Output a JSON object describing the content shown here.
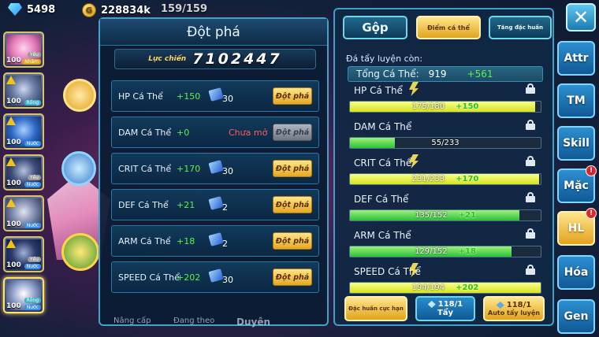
{
  "currency": {
    "gems": "5498",
    "coins": "228834k",
    "stamina": "159/159"
  },
  "party": [
    {
      "level": "100",
      "tag_top": "Yếu",
      "tag_bottom": "Nhâm"
    },
    {
      "level": "100",
      "tag_top": "",
      "tag_bottom": "Rồng"
    },
    {
      "level": "100",
      "tag_top": "",
      "tag_bottom": "Nước"
    },
    {
      "level": "100",
      "tag_top": "Yếu",
      "tag_bottom": "Nước"
    },
    {
      "level": "100",
      "tag_top": "",
      "tag_bottom": "Nước"
    },
    {
      "level": "100",
      "tag_top": "Yếu",
      "tag_bottom": "Nước"
    },
    {
      "level": "100",
      "tag_top": "Rồng",
      "tag_bottom": "Nước"
    }
  ],
  "breakthrough": {
    "title": "Đột phá",
    "power_label": "Lực chiến",
    "power_value": "7102447",
    "rows": [
      {
        "name": "HP Cá Thể",
        "plus": "+150",
        "qty": "30",
        "button": "Đột phá",
        "not_open": ""
      },
      {
        "name": "DAM Cá Thể",
        "plus": "+0",
        "qty": "",
        "button": "Đột phá",
        "not_open": "Chưa mở"
      },
      {
        "name": "CRIT Cá Thể",
        "plus": "+170",
        "qty": "30",
        "button": "Đột phá",
        "not_open": ""
      },
      {
        "name": "DEF Cá Thể",
        "plus": "+21",
        "qty": "2",
        "button": "Đột phá",
        "not_open": ""
      },
      {
        "name": "ARM Cá Thể",
        "plus": "+18",
        "qty": "2",
        "button": "Đột phá",
        "not_open": ""
      },
      {
        "name": "SPEED Cá Thể",
        "plus": "+202",
        "qty": "30",
        "button": "Đột phá",
        "not_open": ""
      }
    ]
  },
  "bottom_tabs": [
    "Nâng cấp",
    "Đang theo",
    "Duyên"
  ],
  "stats_panel": {
    "tabs": {
      "merge": "Gộp",
      "individual": "Điểm cá thể",
      "special": "Tăng đặc huấn"
    },
    "remain_label": "Đá tẩy luyện còn:",
    "total": {
      "name": "Tổng Cá Thể:",
      "value": "919",
      "plus": "+561"
    },
    "stats": [
      {
        "name": "HP Cá Thể",
        "value": "175/180",
        "plus": "+150",
        "fill": 0.97,
        "maxed": true
      },
      {
        "name": "DAM Cá Thể",
        "value": "55/233",
        "plus": "",
        "fill": 0.236,
        "maxed": false
      },
      {
        "name": "CRIT Cá Thể",
        "value": "231/233",
        "plus": "+170",
        "fill": 0.99,
        "maxed": true
      },
      {
        "name": "DEF Cá Thể",
        "value": "135/152",
        "plus": "+21",
        "fill": 0.888,
        "maxed": false
      },
      {
        "name": "ARM Cá Thể",
        "value": "129/152",
        "plus": "+18",
        "fill": 0.849,
        "maxed": false
      },
      {
        "name": "SPEED Cá Thể",
        "value": "194/194",
        "plus": "+202",
        "fill": 1.0,
        "maxed": true
      }
    ],
    "actions": {
      "special_train": "Đặc huấn cực hạn",
      "wash_count": "118/1",
      "wash_label": "Tẩy",
      "auto_count": "118/1",
      "auto_label": "Auto tẩy luyện"
    }
  },
  "side_menu": {
    "close": "✕",
    "items": [
      {
        "label": "Attr",
        "badge": ""
      },
      {
        "label": "TM",
        "badge": ""
      },
      {
        "label": "Skill",
        "badge": ""
      },
      {
        "label": "Mặc",
        "badge": "!"
      },
      {
        "label": "HL",
        "badge": "!"
      },
      {
        "label": "Hóa",
        "badge": ""
      },
      {
        "label": "Gen",
        "badge": ""
      }
    ]
  }
}
